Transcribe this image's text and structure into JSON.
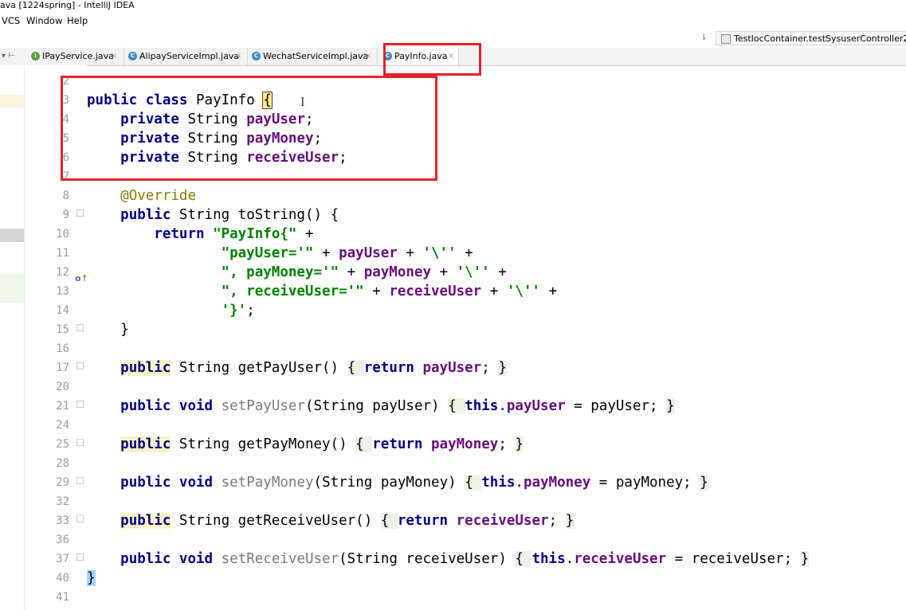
{
  "window": {
    "title": "ava [1224spring] - IntelliJ IDEA"
  },
  "menu": [
    {
      "label": "VCS"
    },
    {
      "label": "Window"
    },
    {
      "label": "Help"
    }
  ],
  "run_config": {
    "label": "TestIocContainer.testSysuserController2"
  },
  "tabs": [
    {
      "label": "IPayService.java",
      "icon": "interface-icon",
      "active": false
    },
    {
      "label": "AlipayServiceImpl.java",
      "icon": "class-icon",
      "active": false
    },
    {
      "label": "WechatServiceImpl.java",
      "icon": "class-icon",
      "active": false
    },
    {
      "label": "PayInfo.java",
      "icon": "class-icon",
      "active": true
    }
  ],
  "line_numbers": [
    "2",
    "3",
    "4",
    "5",
    "6",
    "7",
    "8",
    "9",
    "10",
    "11",
    "12",
    "13",
    "14",
    "15",
    "16",
    "17",
    "20",
    "21",
    "24",
    "25",
    "28",
    "29",
    "32",
    "33",
    "36",
    "37",
    "40",
    "41"
  ],
  "code": {
    "l3": {
      "kw1": "public",
      "kw2": "class",
      "name": "PayInfo",
      "brace": "{"
    },
    "l4": {
      "kw": "private",
      "type": "String",
      "field": "payUser",
      "end": ";"
    },
    "l5": {
      "kw": "private",
      "type": "String",
      "field": "payMoney",
      "end": ";"
    },
    "l6": {
      "kw": "private",
      "type": "String",
      "field": "receiveUser",
      "end": ";"
    },
    "l8": {
      "annotation": "@Override"
    },
    "l9": {
      "kw": "public",
      "rest": "String toString() {"
    },
    "l10": {
      "kw": "return",
      "str": "\"PayInfo{\"",
      "rest": " +"
    },
    "l11": {
      "str": "\"payUser='\"",
      "op1": " + ",
      "field": "payUser",
      "op2": " + ",
      "chr": "'\\''",
      "end": " +"
    },
    "l12": {
      "str": "\", payMoney='\"",
      "op1": " + ",
      "field": "payMoney",
      "op2": " + ",
      "chr": "'\\''",
      "end": " +"
    },
    "l13": {
      "str": "\", receiveUser='\"",
      "op1": " + ",
      "field": "receiveUser",
      "op2": " + ",
      "chr": "'\\''",
      "end": " +"
    },
    "l14": {
      "chr": "'}'",
      "end": ";"
    },
    "l15": {
      "text": "}"
    },
    "l17": {
      "kw": "public",
      "mid": " String getPayUser() ",
      "ob": "{ ",
      "kw2": "return",
      "sp": " ",
      "field": "payUser",
      "semi": "; ",
      "cb": "}"
    },
    "l21": {
      "kw1": "public",
      "kw2": "void",
      "method": "setPayUser",
      "params": "(String payUser) ",
      "ob": "{ ",
      "this": "this",
      "dot": ".",
      "field": "payUser",
      "assign": " = payUser; ",
      "cb": "}"
    },
    "l25": {
      "kw": "public",
      "mid": " String getPayMoney() ",
      "ob": "{ ",
      "kw2": "return",
      "sp": " ",
      "field": "payMoney",
      "semi": "; ",
      "cb": "}"
    },
    "l29": {
      "kw1": "public",
      "kw2": "void",
      "method": "setPayMoney",
      "params": "(String payMoney) ",
      "ob": "{ ",
      "this": "this",
      "dot": ".",
      "field": "payMoney",
      "assign": " = payMoney; ",
      "cb": "}"
    },
    "l33": {
      "kw": "public",
      "mid": " String getReceiveUser() ",
      "ob": "{ ",
      "kw2": "return",
      "sp": " ",
      "field": "receiveUser",
      "semi": "; ",
      "cb": "}"
    },
    "l37": {
      "kw1": "public",
      "kw2": "void",
      "method": "setReceiveUser",
      "params": "(String receiveUser) ",
      "ob": "{ ",
      "this": "this",
      "dot": ".",
      "field": "receiveUser",
      "assign": " = receiveUser; ",
      "cb": "}"
    },
    "l40": {
      "text": "}"
    }
  },
  "colors": {
    "annotation_box": "#e1232b",
    "keyword": "#000080",
    "field": "#660e7a",
    "string": "#008000",
    "annotation": "#808000"
  }
}
